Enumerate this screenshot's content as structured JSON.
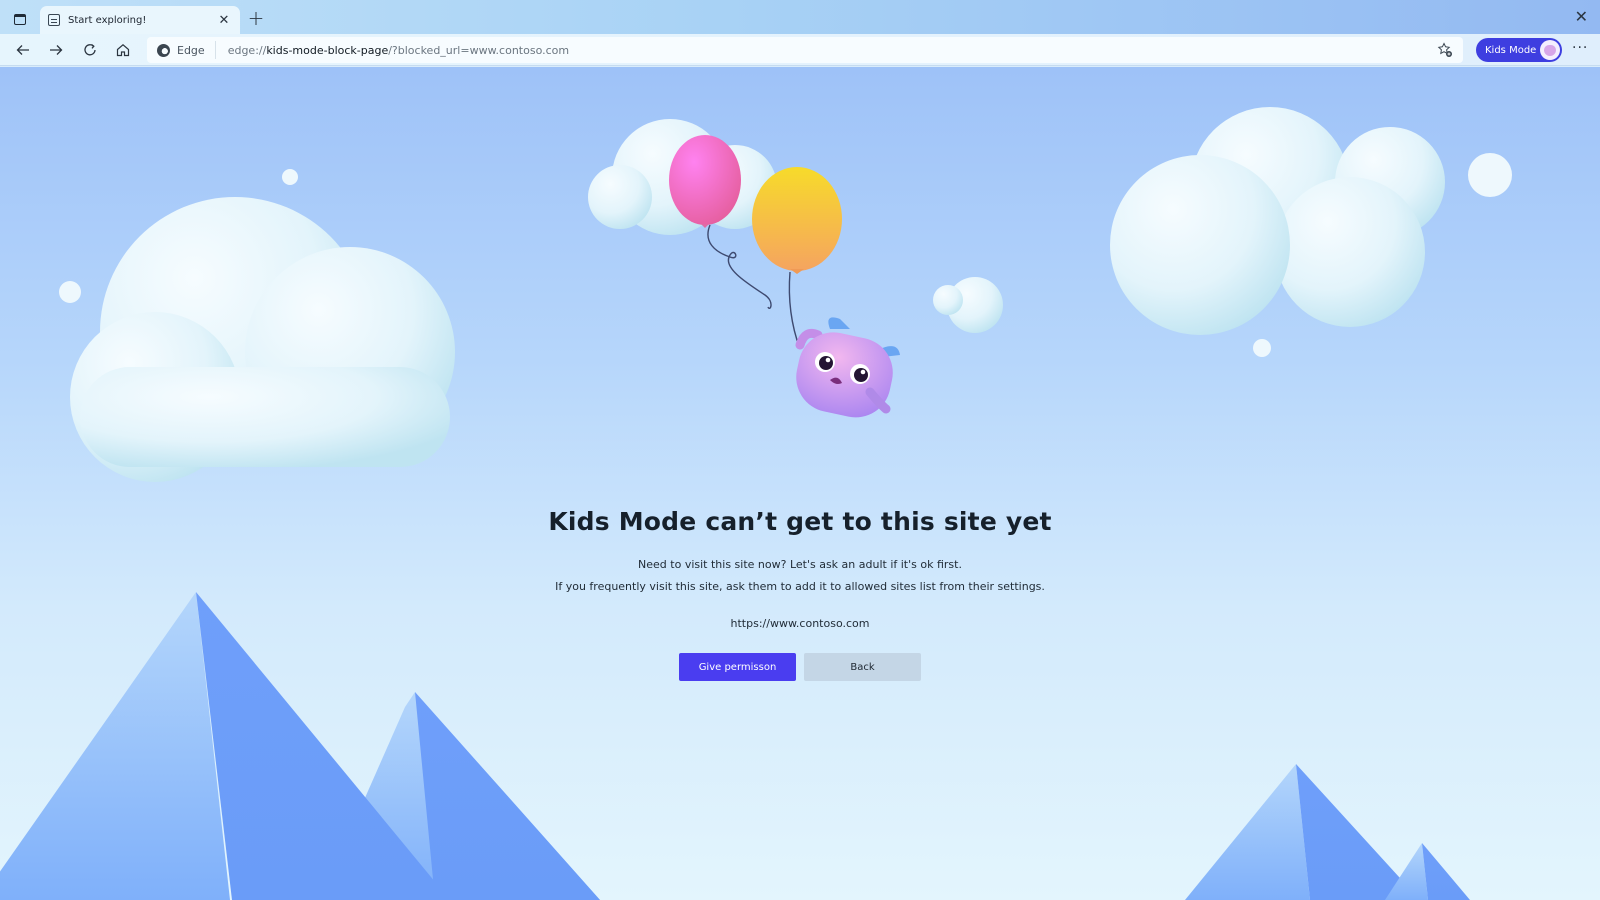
{
  "browser": {
    "tab": {
      "title": "Start exploring!",
      "icon": "page-icon",
      "close_icon": "close-icon"
    },
    "new_tab_icon": "plus-icon",
    "window_close_icon": "close-icon",
    "nav": {
      "back_icon": "arrow-left-icon",
      "forward_icon": "arrow-right-icon",
      "refresh_icon": "refresh-icon",
      "home_icon": "home-icon"
    },
    "address_bar": {
      "badge_label": "Edge",
      "url_prefix": "edge://",
      "url_host": "kids-mode-block-page",
      "url_suffix": "/?blocked_url=www.contoso.com",
      "favorite_icon": "star-add-icon"
    },
    "profile": {
      "label": "Kids Mode",
      "color": "#3e3ee0",
      "avatar_icon": "kids-avatar-icon"
    },
    "more_icon": "ellipsis-icon"
  },
  "page": {
    "headline": "Kids Mode can’t get to this site yet",
    "line1": "Need to visit this site now? Let's ask an adult if it's ok first.",
    "line2": "If you frequently visit this site, ask them to add it to allowed sites list from their settings.",
    "blocked_site": "https://www.contoso.com",
    "primary_button": "Give permisson",
    "secondary_button": "Back",
    "colors": {
      "primary": "#4a3df0",
      "secondary": "#c4d6e6"
    },
    "illustration": {
      "balloons": [
        "pink",
        "yellow"
      ],
      "character": "purple monster holding balloon"
    }
  }
}
